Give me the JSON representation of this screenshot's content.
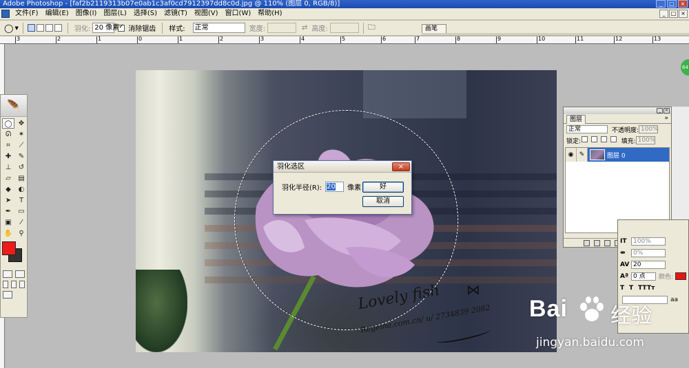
{
  "window": {
    "title": "Adobe Photoshop - [faf2b2119313b07e0ab1c3af0cd7912397dd8c0d.jpg @ 110% (图层 0, RGB/8)]",
    "min": "_",
    "max": "□",
    "close": "×"
  },
  "menu": [
    "文件(F)",
    "编辑(E)",
    "图像(I)",
    "图层(L)",
    "选择(S)",
    "滤镜(T)",
    "视图(V)",
    "窗口(W)",
    "帮助(H)"
  ],
  "options": {
    "feather_label": "羽化:",
    "feather_value": "20 像素",
    "antialias_label": "消除锯齿",
    "style_label": "样式:",
    "style_value": "正常",
    "width_label": "宽度:",
    "height_label": "高度:",
    "palette_tab": "画笔"
  },
  "ruler_ticks": [
    "3",
    "2",
    "1",
    "0",
    "1",
    "2",
    "3",
    "4",
    "5",
    "6",
    "7",
    "8",
    "9",
    "10",
    "11",
    "12",
    "13"
  ],
  "dialog": {
    "title": "羽化选区",
    "close": "×",
    "radius_label": "羽化半径(R):",
    "radius_value": "20",
    "unit": "像素",
    "ok": "好",
    "cancel": "取消"
  },
  "photo": {
    "signature": "Lovely fish",
    "url_text": "Regeina.com.cn/ u/ 2734839 2082"
  },
  "layers_panel": {
    "tab": "图层",
    "menu_icon": "»",
    "blend_mode": "正常",
    "opacity_label": "不透明度:",
    "opacity_value": "100%",
    "lock_label": "锁定:",
    "fill_label": "填充:",
    "fill_value": "100%",
    "layer_name": "图层 0",
    "eye_icon": "eye-icon"
  },
  "char_panel": {
    "leading_value": "100%",
    "tracking_value": "0%",
    "kerning_value": "20",
    "baseline_value": "0 点",
    "color_label": "颜色:",
    "aa_label": "aa"
  },
  "baidu": {
    "brand": "Bai",
    "brand_cn": "经验",
    "url": "jingyan.baidu.com"
  },
  "colors": {
    "foreground": "#ee1b1b",
    "background": "#333333",
    "selection": "#316ac5"
  }
}
